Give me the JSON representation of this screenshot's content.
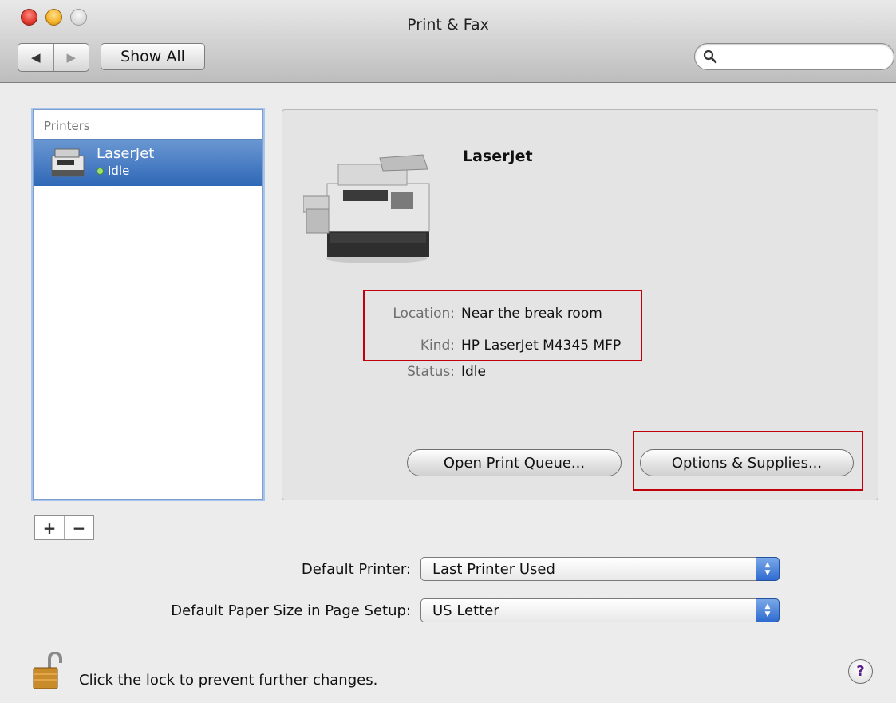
{
  "window": {
    "title": "Print & Fax"
  },
  "toolbar": {
    "back_glyph": "◀",
    "forward_glyph": "▶",
    "show_all": "Show All",
    "search_placeholder": "",
    "search_value": ""
  },
  "printers": {
    "header": "Printers",
    "items": [
      {
        "name": "LaserJet",
        "status": "Idle",
        "status_color": "#8fdc5a"
      }
    ],
    "add_glyph": "+",
    "remove_glyph": "−"
  },
  "detail": {
    "name": "LaserJet",
    "fields": [
      {
        "label": "Location:",
        "value": "Near the break room"
      },
      {
        "label": "Kind:",
        "value": "HP LaserJet M4345 MFP"
      },
      {
        "label": "Status:",
        "value": "Idle"
      }
    ],
    "open_queue": "Open Print Queue...",
    "options_supplies": "Options & Supplies..."
  },
  "defaults": {
    "printer_label": "Default Printer:",
    "printer_value": "Last Printer Used",
    "paper_label": "Default Paper Size in Page Setup:",
    "paper_value": "US Letter"
  },
  "footer": {
    "lock_text": "Click the lock to prevent further changes.",
    "help_glyph": "?"
  },
  "colors": {
    "selection": "#3a6fbf",
    "highlight_box": "#c0000c",
    "accent_blue": "#2f6bd0"
  }
}
